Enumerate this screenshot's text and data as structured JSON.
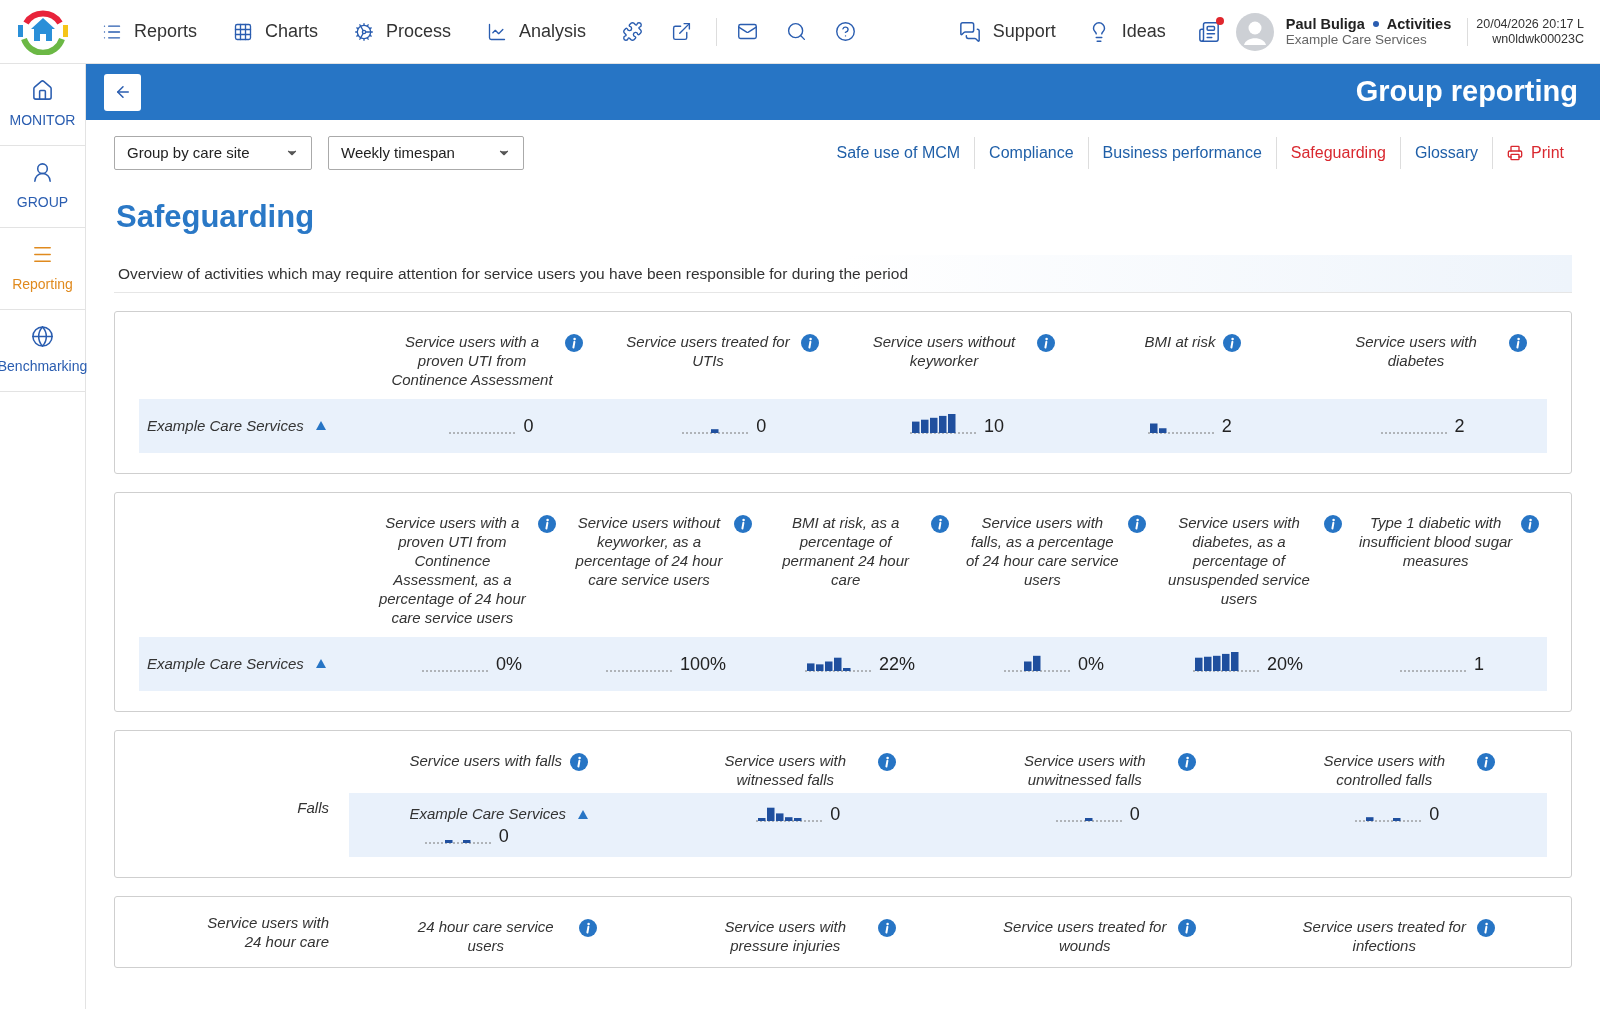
{
  "nav": {
    "items": [
      {
        "label": "Reports"
      },
      {
        "label": "Charts"
      },
      {
        "label": "Process"
      },
      {
        "label": "Analysis"
      }
    ],
    "right_items": [
      {
        "label": "Support"
      },
      {
        "label": "Ideas"
      }
    ],
    "user": {
      "name": "Paul Buliga",
      "activity": "Activities",
      "org": "Example Care Services"
    },
    "datetime": "20/04/2026 20:17 L",
    "device": "wn0ldwk00023C"
  },
  "sidebar": {
    "items": [
      {
        "label": "MONITOR",
        "selected": false
      },
      {
        "label": "GROUP",
        "selected": false
      },
      {
        "label": "Reporting",
        "selected": true
      },
      {
        "label": "Benchmarking",
        "selected": false
      }
    ]
  },
  "header": {
    "title": "Group reporting"
  },
  "filters": [
    {
      "value": "Group by care site"
    },
    {
      "value": "Weekly timespan"
    }
  ],
  "links": [
    {
      "label": "Safe use of MCM",
      "selected": false
    },
    {
      "label": "Compliance",
      "selected": false
    },
    {
      "label": "Business performance",
      "selected": false
    },
    {
      "label": "Safeguarding",
      "selected": true
    },
    {
      "label": "Glossary",
      "selected": false
    }
  ],
  "print": "Print",
  "title": "Safeguarding",
  "description": "Overview of activities which may require attention for service users you have been responsible for during the period",
  "panels": [
    {
      "kind": "table",
      "columns": [
        "Service users with a proven UTI from Continence Assessment",
        "Service users treated for UTIs",
        "Service users without keyworker",
        "BMI at risk",
        "Service users with diabetes"
      ],
      "rows": [
        {
          "label": "Example Care Services",
          "expanded": true,
          "values": [
            "0",
            "0",
            "10",
            "2",
            "2"
          ]
        }
      ]
    },
    {
      "kind": "table",
      "columns": [
        "Service users with a proven UTI from Continence Assessment, as a percentage of 24 hour care service users",
        "Service users without keyworker, as a percentage of 24 hour care service users",
        "BMI at risk, as a percentage of permanent 24 hour care",
        "Service users with falls, as a percentage of 24 hour care service users",
        "Service users with diabetes, as a percentage of unsuspended service users",
        "Type 1 diabetic with insufficient blood sugar measures"
      ],
      "rows": [
        {
          "label": "Example Care Services",
          "expanded": true,
          "values": [
            "0%",
            "100%",
            "22%",
            "0%",
            "20%",
            "1"
          ]
        }
      ]
    },
    {
      "kind": "grouped",
      "label": "Falls",
      "columns": [
        "Service users with falls",
        "Service users with witnessed falls",
        "Service users with unwitnessed falls",
        "Service users with controlled falls"
      ],
      "rows": [
        {
          "label": "Example Care Services",
          "expanded": true,
          "values": [
            "0",
            "0",
            "0",
            "0"
          ]
        }
      ]
    },
    {
      "kind": "heading",
      "label": "Service users with 24 hour care",
      "columns": [
        "24 hour care service users",
        "Service users with pressure injuries",
        "Service users treated for wounds",
        "Service users treated for infections"
      ]
    }
  ]
}
